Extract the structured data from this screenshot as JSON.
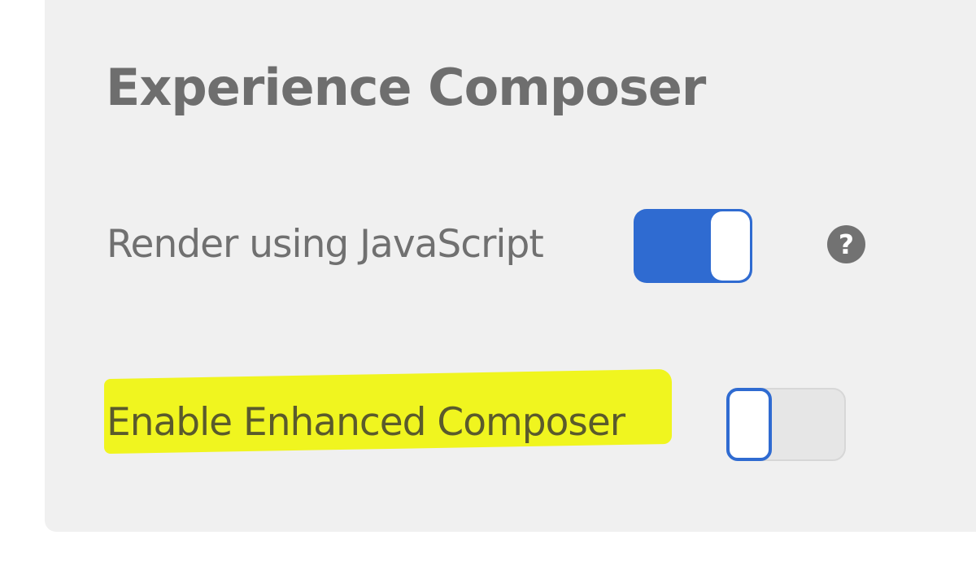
{
  "section": {
    "title": "Experience Composer"
  },
  "settings": [
    {
      "label": "Render using JavaScript",
      "enabled": true,
      "help_icon": "question-circle-icon",
      "help_glyph": "?"
    },
    {
      "label": "Enable Enhanced Composer",
      "enabled": false,
      "highlighted": true
    }
  ],
  "colors": {
    "panel_background": "#f0f0f0",
    "toggle_on": "#2f6bd1",
    "toggle_off": "#e6e6e6",
    "highlight": "#f0f51f",
    "text": "#707070",
    "help_icon": "#727272"
  }
}
